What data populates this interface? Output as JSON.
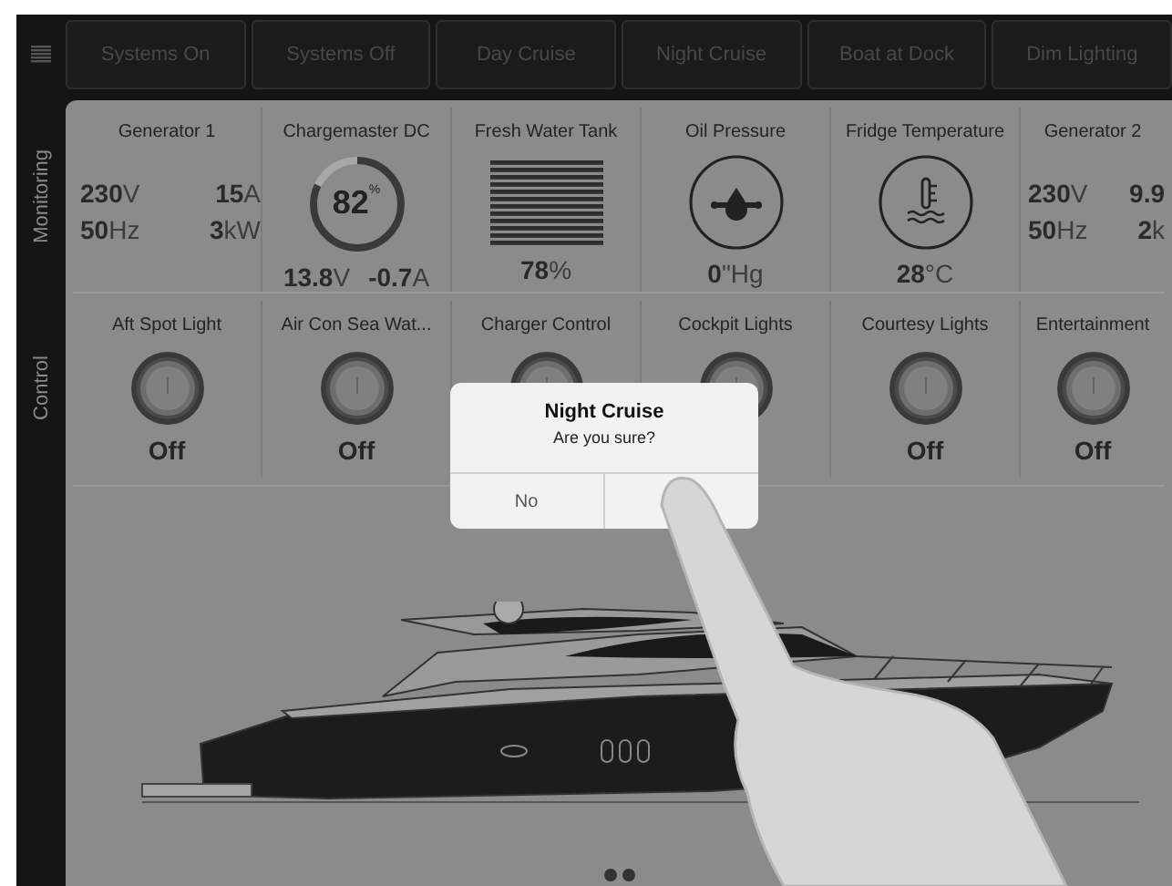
{
  "scenes": [
    {
      "label": "Systems On"
    },
    {
      "label": "Systems Off"
    },
    {
      "label": "Day Cruise"
    },
    {
      "label": "Night Cruise"
    },
    {
      "label": "Boat at Dock"
    },
    {
      "label": "Dim Lighting"
    }
  ],
  "sections": [
    {
      "label": "Monitoring"
    },
    {
      "label": "Control"
    }
  ],
  "monitoring": [
    {
      "kind": "electric",
      "title": "Generator 1",
      "readings": [
        {
          "value": "230",
          "unit": "V"
        },
        {
          "value": "15",
          "unit": "A"
        },
        {
          "value": "50",
          "unit": "Hz"
        },
        {
          "value": "3",
          "unit": "kW"
        }
      ]
    },
    {
      "kind": "gauge",
      "title": "Chargemaster DC",
      "level": 0.82,
      "center": {
        "value": "82",
        "unit": "%"
      },
      "readings": [
        {
          "value": "13.8",
          "unit": "V"
        },
        {
          "value": "-0.7",
          "unit": "A"
        }
      ]
    },
    {
      "kind": "tank",
      "title": "Fresh Water Tank",
      "readings": [
        {
          "value": "78",
          "unit": "%"
        }
      ]
    },
    {
      "kind": "pressure",
      "title": "Oil Pressure",
      "readings": [
        {
          "value": "0",
          "unit": "\"Hg"
        }
      ]
    },
    {
      "kind": "temperature",
      "title": "Fridge Temperature",
      "readings": [
        {
          "value": "28",
          "unit": "°C"
        }
      ]
    },
    {
      "kind": "electric",
      "title": "Generator 2",
      "readings": [
        {
          "value": "230",
          "unit": "V"
        },
        {
          "value": "9.9"
        },
        {
          "value": "50",
          "unit": "Hz"
        },
        {
          "value": "2",
          "unit": "k"
        }
      ]
    }
  ],
  "controls": [
    {
      "title": "Aft Spot Light",
      "on": false,
      "state": "Off"
    },
    {
      "title": "Air Con Sea Wat...",
      "on": false,
      "state": "Off"
    },
    {
      "title": "Charger Control",
      "on": false
    },
    {
      "title": "Cockpit Lights",
      "on": false
    },
    {
      "title": "Courtesy Lights",
      "on": false,
      "state": "Off"
    },
    {
      "title": "Entertainment",
      "on": false,
      "state": "Off"
    }
  ],
  "dialog": {
    "title": "Night Cruise",
    "message": "Are you sure?",
    "buttons": [
      "No"
    ]
  }
}
